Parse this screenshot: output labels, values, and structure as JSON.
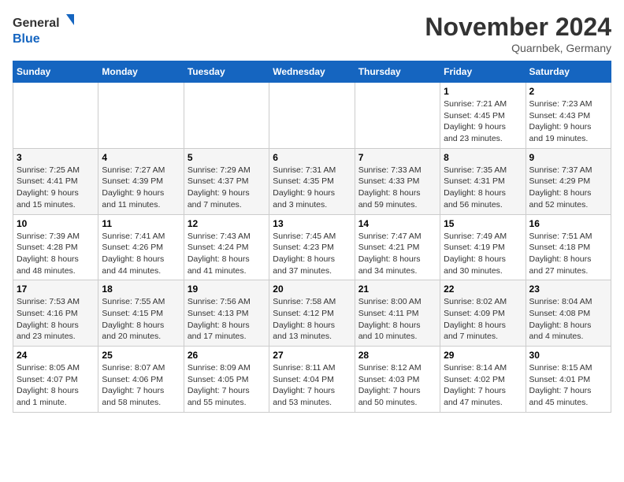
{
  "header": {
    "logo_line1": "General",
    "logo_line2": "Blue",
    "month": "November 2024",
    "location": "Quarnbek, Germany"
  },
  "weekdays": [
    "Sunday",
    "Monday",
    "Tuesday",
    "Wednesday",
    "Thursday",
    "Friday",
    "Saturday"
  ],
  "weeks": [
    [
      {
        "day": "",
        "info": ""
      },
      {
        "day": "",
        "info": ""
      },
      {
        "day": "",
        "info": ""
      },
      {
        "day": "",
        "info": ""
      },
      {
        "day": "",
        "info": ""
      },
      {
        "day": "1",
        "info": "Sunrise: 7:21 AM\nSunset: 4:45 PM\nDaylight: 9 hours\nand 23 minutes."
      },
      {
        "day": "2",
        "info": "Sunrise: 7:23 AM\nSunset: 4:43 PM\nDaylight: 9 hours\nand 19 minutes."
      }
    ],
    [
      {
        "day": "3",
        "info": "Sunrise: 7:25 AM\nSunset: 4:41 PM\nDaylight: 9 hours\nand 15 minutes."
      },
      {
        "day": "4",
        "info": "Sunrise: 7:27 AM\nSunset: 4:39 PM\nDaylight: 9 hours\nand 11 minutes."
      },
      {
        "day": "5",
        "info": "Sunrise: 7:29 AM\nSunset: 4:37 PM\nDaylight: 9 hours\nand 7 minutes."
      },
      {
        "day": "6",
        "info": "Sunrise: 7:31 AM\nSunset: 4:35 PM\nDaylight: 9 hours\nand 3 minutes."
      },
      {
        "day": "7",
        "info": "Sunrise: 7:33 AM\nSunset: 4:33 PM\nDaylight: 8 hours\nand 59 minutes."
      },
      {
        "day": "8",
        "info": "Sunrise: 7:35 AM\nSunset: 4:31 PM\nDaylight: 8 hours\nand 56 minutes."
      },
      {
        "day": "9",
        "info": "Sunrise: 7:37 AM\nSunset: 4:29 PM\nDaylight: 8 hours\nand 52 minutes."
      }
    ],
    [
      {
        "day": "10",
        "info": "Sunrise: 7:39 AM\nSunset: 4:28 PM\nDaylight: 8 hours\nand 48 minutes."
      },
      {
        "day": "11",
        "info": "Sunrise: 7:41 AM\nSunset: 4:26 PM\nDaylight: 8 hours\nand 44 minutes."
      },
      {
        "day": "12",
        "info": "Sunrise: 7:43 AM\nSunset: 4:24 PM\nDaylight: 8 hours\nand 41 minutes."
      },
      {
        "day": "13",
        "info": "Sunrise: 7:45 AM\nSunset: 4:23 PM\nDaylight: 8 hours\nand 37 minutes."
      },
      {
        "day": "14",
        "info": "Sunrise: 7:47 AM\nSunset: 4:21 PM\nDaylight: 8 hours\nand 34 minutes."
      },
      {
        "day": "15",
        "info": "Sunrise: 7:49 AM\nSunset: 4:19 PM\nDaylight: 8 hours\nand 30 minutes."
      },
      {
        "day": "16",
        "info": "Sunrise: 7:51 AM\nSunset: 4:18 PM\nDaylight: 8 hours\nand 27 minutes."
      }
    ],
    [
      {
        "day": "17",
        "info": "Sunrise: 7:53 AM\nSunset: 4:16 PM\nDaylight: 8 hours\nand 23 minutes."
      },
      {
        "day": "18",
        "info": "Sunrise: 7:55 AM\nSunset: 4:15 PM\nDaylight: 8 hours\nand 20 minutes."
      },
      {
        "day": "19",
        "info": "Sunrise: 7:56 AM\nSunset: 4:13 PM\nDaylight: 8 hours\nand 17 minutes."
      },
      {
        "day": "20",
        "info": "Sunrise: 7:58 AM\nSunset: 4:12 PM\nDaylight: 8 hours\nand 13 minutes."
      },
      {
        "day": "21",
        "info": "Sunrise: 8:00 AM\nSunset: 4:11 PM\nDaylight: 8 hours\nand 10 minutes."
      },
      {
        "day": "22",
        "info": "Sunrise: 8:02 AM\nSunset: 4:09 PM\nDaylight: 8 hours\nand 7 minutes."
      },
      {
        "day": "23",
        "info": "Sunrise: 8:04 AM\nSunset: 4:08 PM\nDaylight: 8 hours\nand 4 minutes."
      }
    ],
    [
      {
        "day": "24",
        "info": "Sunrise: 8:05 AM\nSunset: 4:07 PM\nDaylight: 8 hours\nand 1 minute."
      },
      {
        "day": "25",
        "info": "Sunrise: 8:07 AM\nSunset: 4:06 PM\nDaylight: 7 hours\nand 58 minutes."
      },
      {
        "day": "26",
        "info": "Sunrise: 8:09 AM\nSunset: 4:05 PM\nDaylight: 7 hours\nand 55 minutes."
      },
      {
        "day": "27",
        "info": "Sunrise: 8:11 AM\nSunset: 4:04 PM\nDaylight: 7 hours\nand 53 minutes."
      },
      {
        "day": "28",
        "info": "Sunrise: 8:12 AM\nSunset: 4:03 PM\nDaylight: 7 hours\nand 50 minutes."
      },
      {
        "day": "29",
        "info": "Sunrise: 8:14 AM\nSunset: 4:02 PM\nDaylight: 7 hours\nand 47 minutes."
      },
      {
        "day": "30",
        "info": "Sunrise: 8:15 AM\nSunset: 4:01 PM\nDaylight: 7 hours\nand 45 minutes."
      }
    ]
  ]
}
